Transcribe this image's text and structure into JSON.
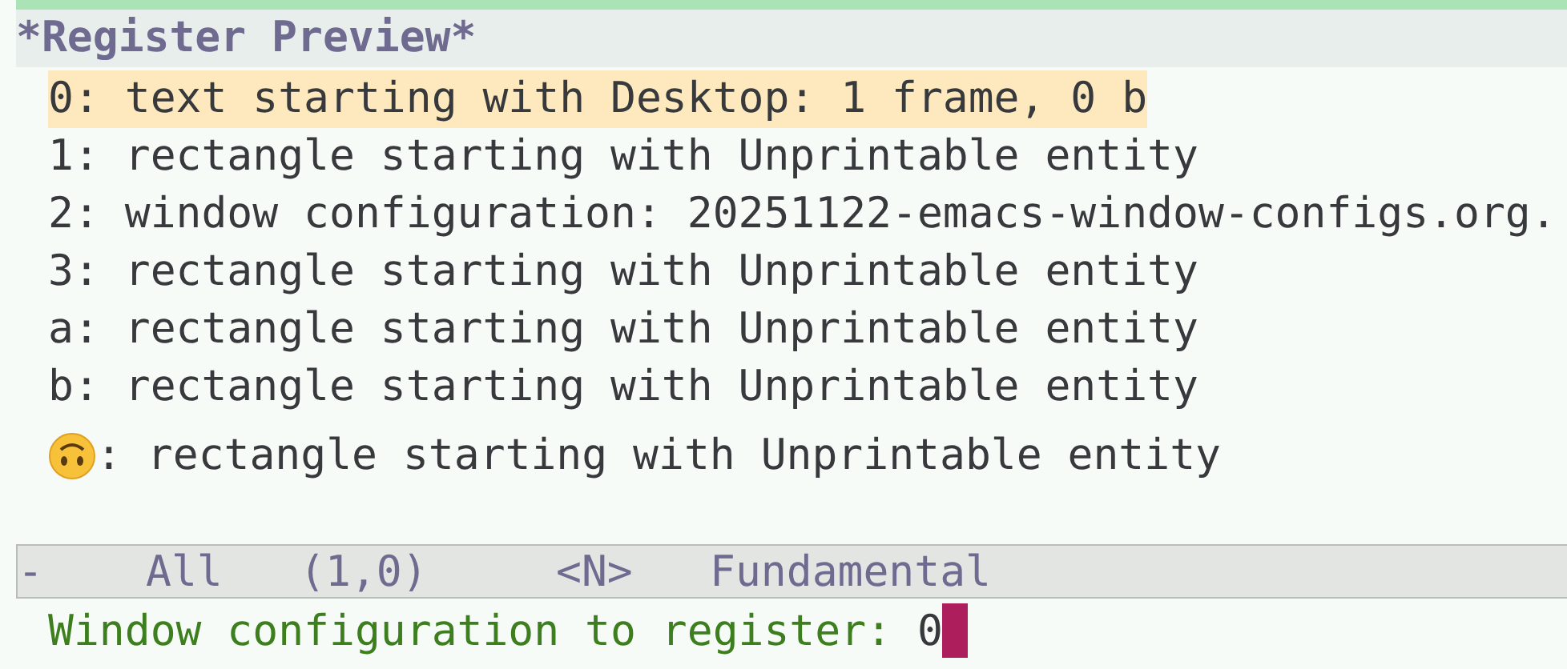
{
  "buffer": {
    "title": "*Register Preview*"
  },
  "registers": [
    {
      "line": "0: text starting with Desktop: 1 frame, 0 b",
      "selected": true,
      "kind": "text"
    },
    {
      "line": "1: rectangle starting with Unprintable entity",
      "selected": false,
      "kind": "text"
    },
    {
      "line": "2: window configuration: 20251122-emacs-window-configs.org.",
      "selected": false,
      "kind": "text"
    },
    {
      "line": "3: rectangle starting with Unprintable entity",
      "selected": false,
      "kind": "text"
    },
    {
      "line": "a: rectangle starting with Unprintable entity",
      "selected": false,
      "kind": "text"
    },
    {
      "line": "b: rectangle starting with Unprintable entity",
      "selected": false,
      "kind": "text"
    },
    {
      "line": ": rectangle starting with Unprintable entity",
      "selected": false,
      "kind": "emoji"
    }
  ],
  "mode_line": [
    "-",
    "All",
    "(1,0)",
    "<N>",
    "Fundamental"
  ],
  "minibuffer": {
    "prompt": "Window configuration to register:",
    "value": "0"
  }
}
